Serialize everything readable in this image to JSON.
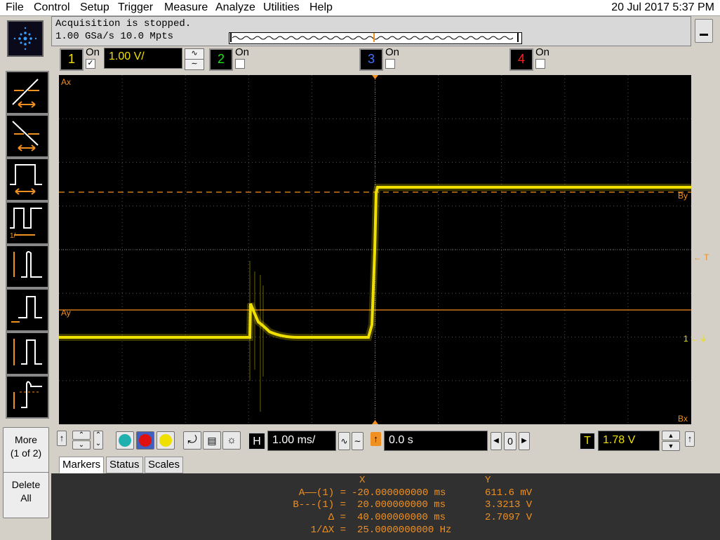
{
  "menu": [
    "File",
    "Control",
    "Setup",
    "Trigger",
    "Measure",
    "Analyze",
    "Utilities",
    "Help"
  ],
  "datetime": "20 Jul 2017   5:37 PM",
  "status": {
    "line1": "Acquisition is stopped.",
    "line2": "1.00 GSa/s   10.0 Mpts"
  },
  "channels": [
    {
      "num": "1",
      "on_label": "On",
      "checked": true,
      "color": "#f0e000",
      "scale": "1.00 V/"
    },
    {
      "num": "2",
      "on_label": "On",
      "checked": false,
      "color": "#20e020"
    },
    {
      "num": "3",
      "on_label": "On",
      "checked": false,
      "color": "#4070ff"
    },
    {
      "num": "4",
      "on_label": "On",
      "checked": false,
      "color": "#ff2020"
    }
  ],
  "more_button": "More\n(1 of 2)",
  "delete_all_button": "Delete\nAll",
  "horizontal": {
    "label": "H",
    "scale": "1.00 ms/",
    "delay": "0.0 s",
    "zero": "0"
  },
  "trigger": {
    "label": "T",
    "level": "1.78 V"
  },
  "tabs": [
    "Markers",
    "Status",
    "Scales"
  ],
  "screen_labels": {
    "ax": "Ax",
    "ay": "Ay",
    "bx": "Bx",
    "by": "By",
    "trig": "T",
    "ch1": "1"
  },
  "markers_table": {
    "header_x": "X",
    "header_y": "Y",
    "rows": [
      {
        "label": "A——(1) =",
        "x": "-20.000000000 ms",
        "y": "611.6 mV"
      },
      {
        "label": "B---(1) =",
        "x": "20.000000000 ms",
        "y": "3.3213 V"
      },
      {
        "label": "Δ =",
        "x": "40.000000000 ms",
        "y": "2.7097 V"
      },
      {
        "label": "1/ΔX =",
        "x": "25.0000000000 Hz",
        "y": ""
      }
    ]
  },
  "colors": {
    "trace": "#f0e000",
    "marker": "#f09020",
    "grid": "#505050",
    "screen_bg": "#000000"
  },
  "icons": [
    "agilent-logo-icon",
    "rise-time-icon",
    "fall-time-icon",
    "pulse-width-icon",
    "period-icon",
    "amplitude-icon",
    "base-icon",
    "top-icon",
    "overshoot-icon"
  ]
}
